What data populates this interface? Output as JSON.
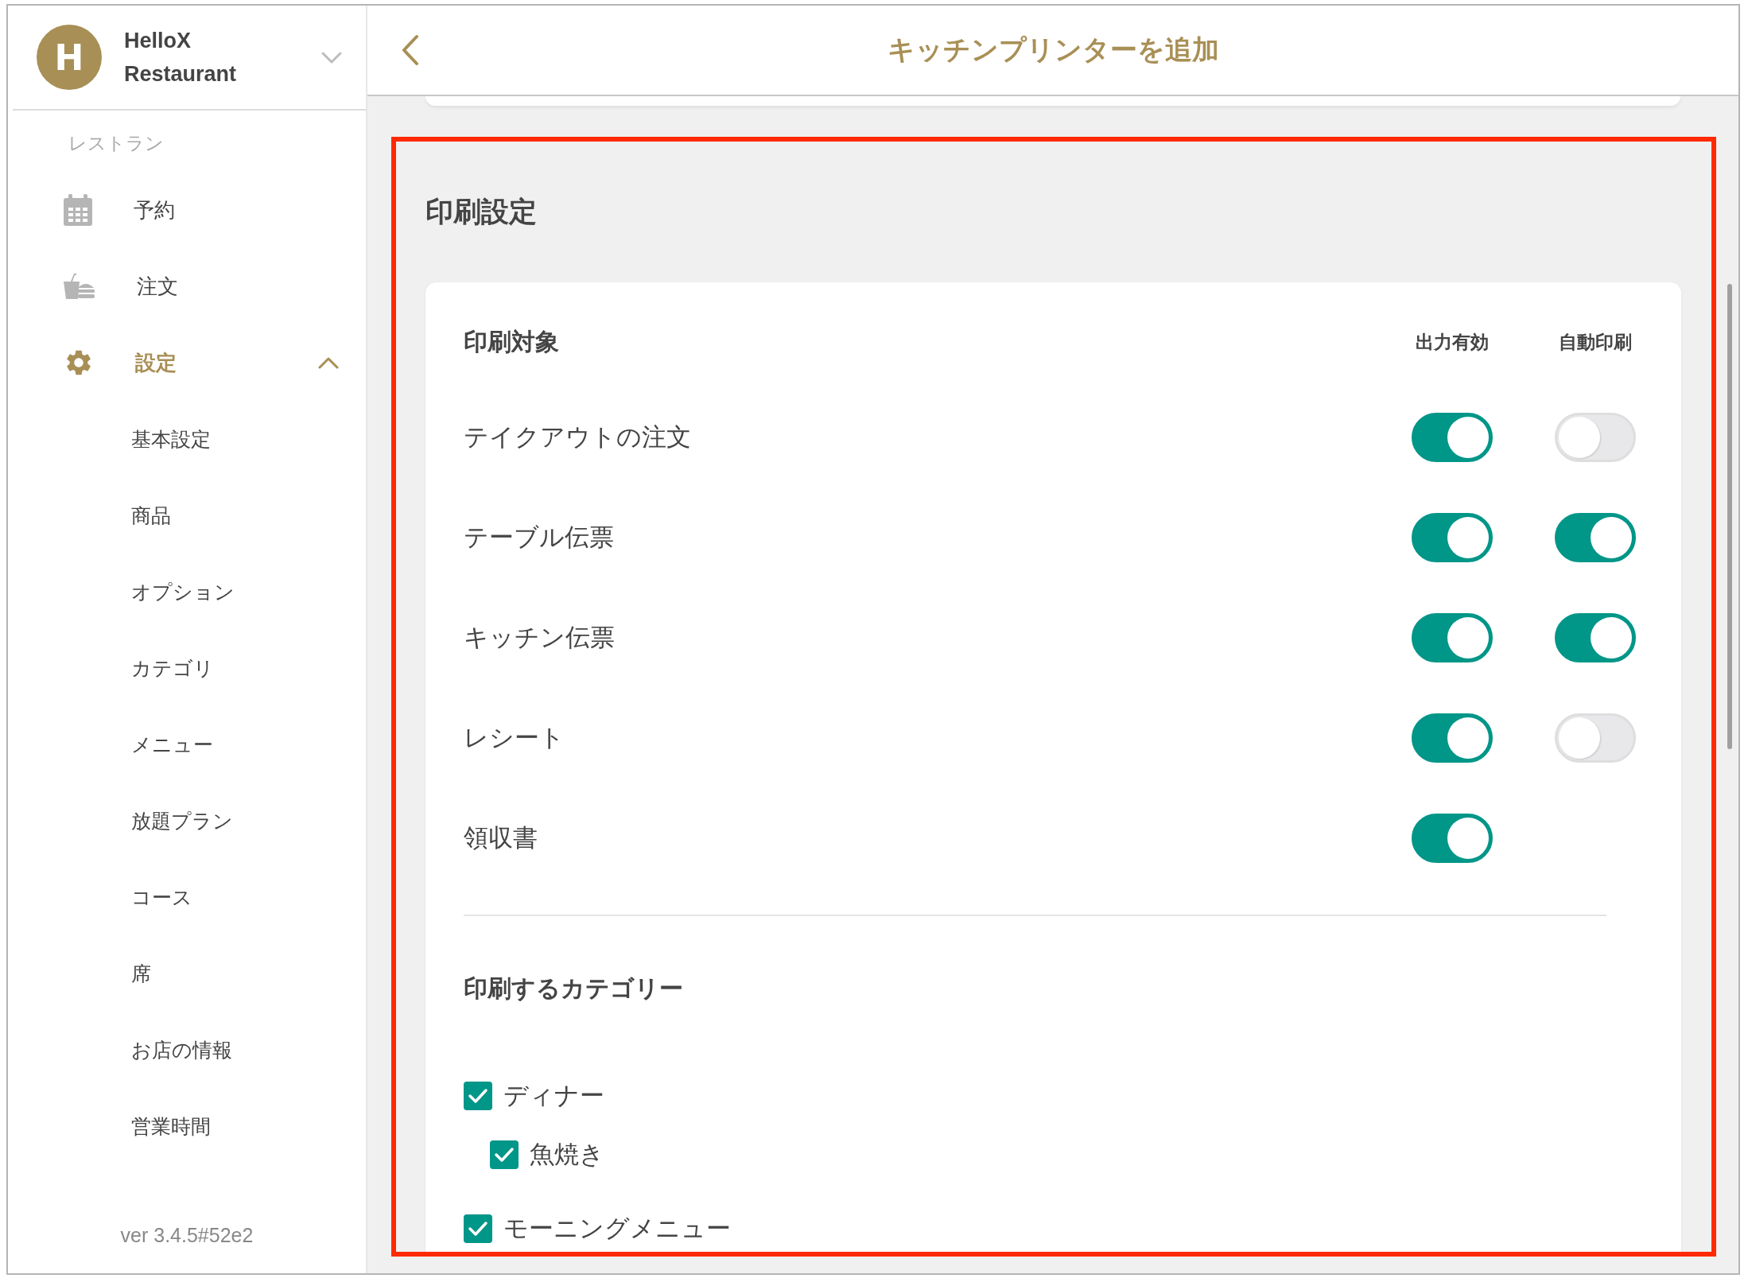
{
  "sidebar": {
    "restaurant": {
      "avatar": "H",
      "name_line1": "HelloX",
      "name_line2": "Restaurant"
    },
    "section_label": "レストラン",
    "items": [
      {
        "label": "予約",
        "kind": "calendar",
        "selected": false
      },
      {
        "label": "注文",
        "kind": "food",
        "selected": false
      },
      {
        "label": "設定",
        "kind": "gear",
        "selected": true,
        "expanded": true,
        "children": [
          {
            "label": "基本設定"
          },
          {
            "label": "商品"
          },
          {
            "label": "オプション"
          },
          {
            "label": "カテゴリ"
          },
          {
            "label": "メニュー"
          },
          {
            "label": "放題プラン"
          },
          {
            "label": "コース"
          },
          {
            "label": "席"
          },
          {
            "label": "お店の情報"
          },
          {
            "label": "営業時間"
          }
        ]
      }
    ],
    "version": "ver 3.4.5#52e2"
  },
  "header": {
    "title": "キッチンプリンターを追加"
  },
  "print_settings": {
    "title": "印刷設定",
    "targets": {
      "title": "印刷対象",
      "columns": [
        "出力有効",
        "自動印刷"
      ],
      "rows": [
        {
          "label": "テイクアウトの注文",
          "output_enabled": true,
          "auto_print": false
        },
        {
          "label": "テーブル伝票",
          "output_enabled": true,
          "auto_print": true
        },
        {
          "label": "キッチン伝票",
          "output_enabled": true,
          "auto_print": true
        },
        {
          "label": "レシート",
          "output_enabled": true,
          "auto_print": false
        },
        {
          "label": "領収書",
          "output_enabled": true
        }
      ]
    },
    "categories": {
      "title": "印刷するカテゴリー",
      "items": [
        {
          "label": "ディナー",
          "checked": true,
          "children": [
            {
              "label": "魚焼き",
              "checked": true
            }
          ]
        },
        {
          "label": "モーニングメニュー",
          "checked": true
        }
      ]
    }
  }
}
